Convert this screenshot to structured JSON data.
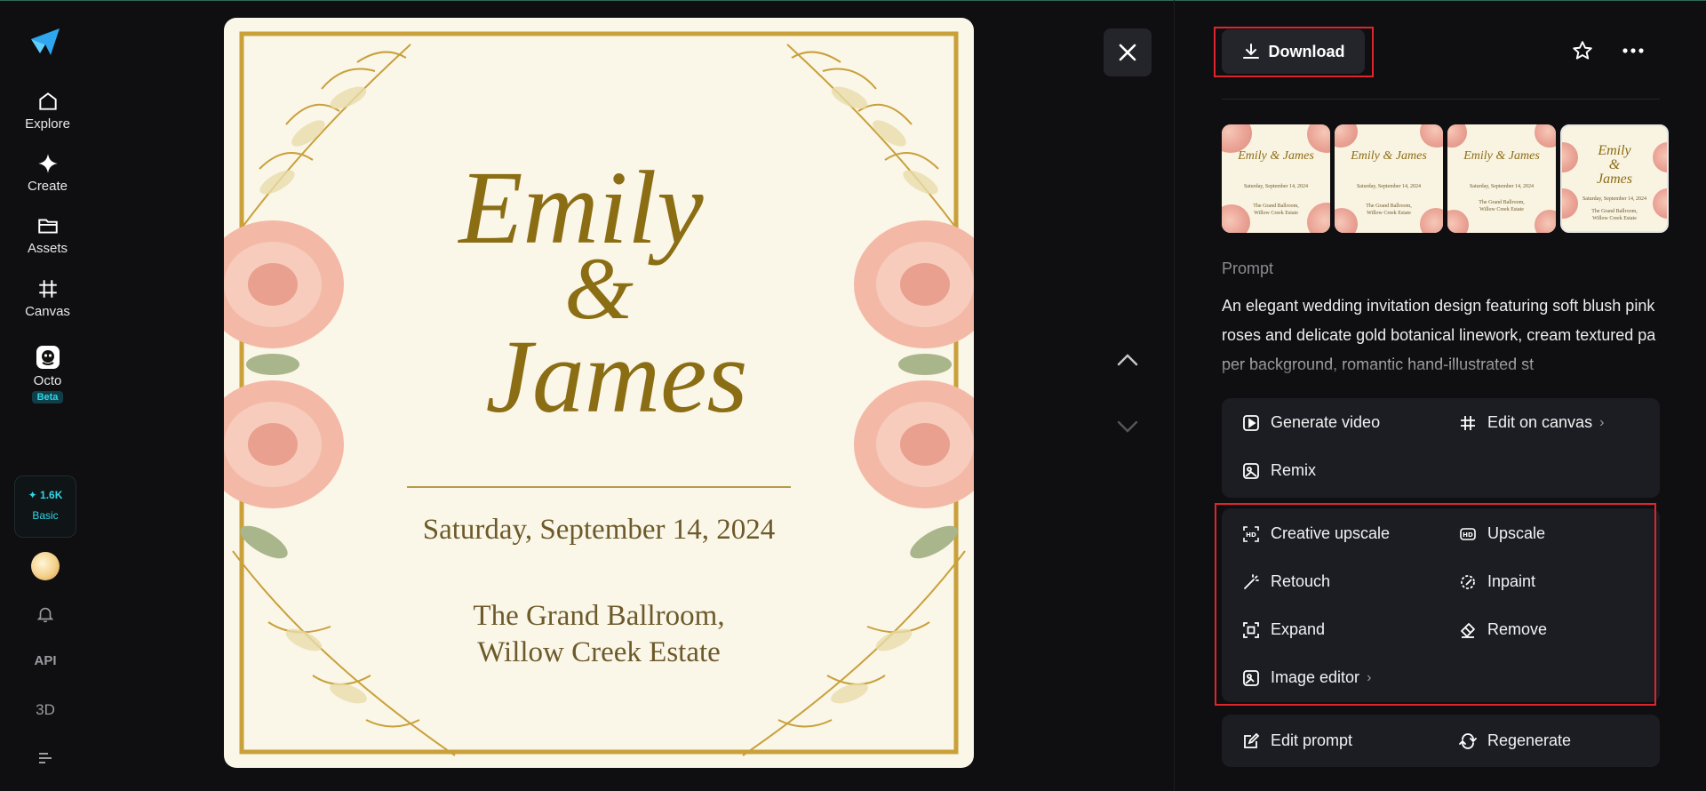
{
  "sidebar": {
    "items": [
      {
        "label": "Explore",
        "icon": "home-icon"
      },
      {
        "label": "Create",
        "icon": "sparkle-icon"
      },
      {
        "label": "Assets",
        "icon": "folder-icon"
      },
      {
        "label": "Canvas",
        "icon": "canvas-icon"
      },
      {
        "label": "Octo",
        "icon": "octo-icon",
        "badge": "Beta"
      }
    ],
    "credits": {
      "amount": "✦ 1.6K",
      "plan": "Basic"
    },
    "bottom": {
      "api": "API",
      "three_d": "3D"
    }
  },
  "invitation": {
    "name_line1": "Emily",
    "ampersand": "&",
    "name_line2": "James",
    "date": "Saturday, September 14, 2024",
    "venue_line1": "The Grand Ballroom,",
    "venue_line2": "Willow Creek Estate"
  },
  "thumbnails": [
    {
      "title": "Emily & James",
      "date": "Saturday, September 14, 2024",
      "venue": "The Grand Ballroom, Willow Creek Estate"
    },
    {
      "title": "Emily & James",
      "date": "Saturday, September 14, 2024",
      "venue": "The Grand Ballroom, Willow Creek Estate"
    },
    {
      "title": "Emily & James",
      "date": "Saturday, September 14, 2024",
      "venue": "The Grand Ballroom, Willow Creek Estate"
    },
    {
      "title_line1": "Emily",
      "title_line2": "&",
      "title_line3": "James",
      "date": "Saturday, September 14, 2024",
      "venue": "The Grand Ballroom, Willow Creek Estate"
    }
  ],
  "panel": {
    "download_label": "Download",
    "prompt_label": "Prompt",
    "prompt_text": "An elegant wedding invitation design featuring soft blush pink roses and delicate gold botanical linework, cream textured paper background, romantic hand-illustrated st",
    "actions_top": {
      "generate_video": "Generate video",
      "edit_on_canvas": "Edit on canvas",
      "remix": "Remix"
    },
    "tools": {
      "creative_upscale": "Creative upscale",
      "upscale": "Upscale",
      "retouch": "Retouch",
      "inpaint": "Inpaint",
      "expand": "Expand",
      "remove": "Remove",
      "image_editor": "Image editor"
    },
    "actions_bottom": {
      "edit_prompt": "Edit prompt",
      "regenerate": "Regenerate"
    }
  },
  "colors": {
    "background": "#0f0f11",
    "card": "#1c1d22",
    "accent_cyan": "#32d4e6",
    "highlight_red": "#e0242c",
    "gold": "#8b6d14",
    "rose": "#eca89a"
  }
}
